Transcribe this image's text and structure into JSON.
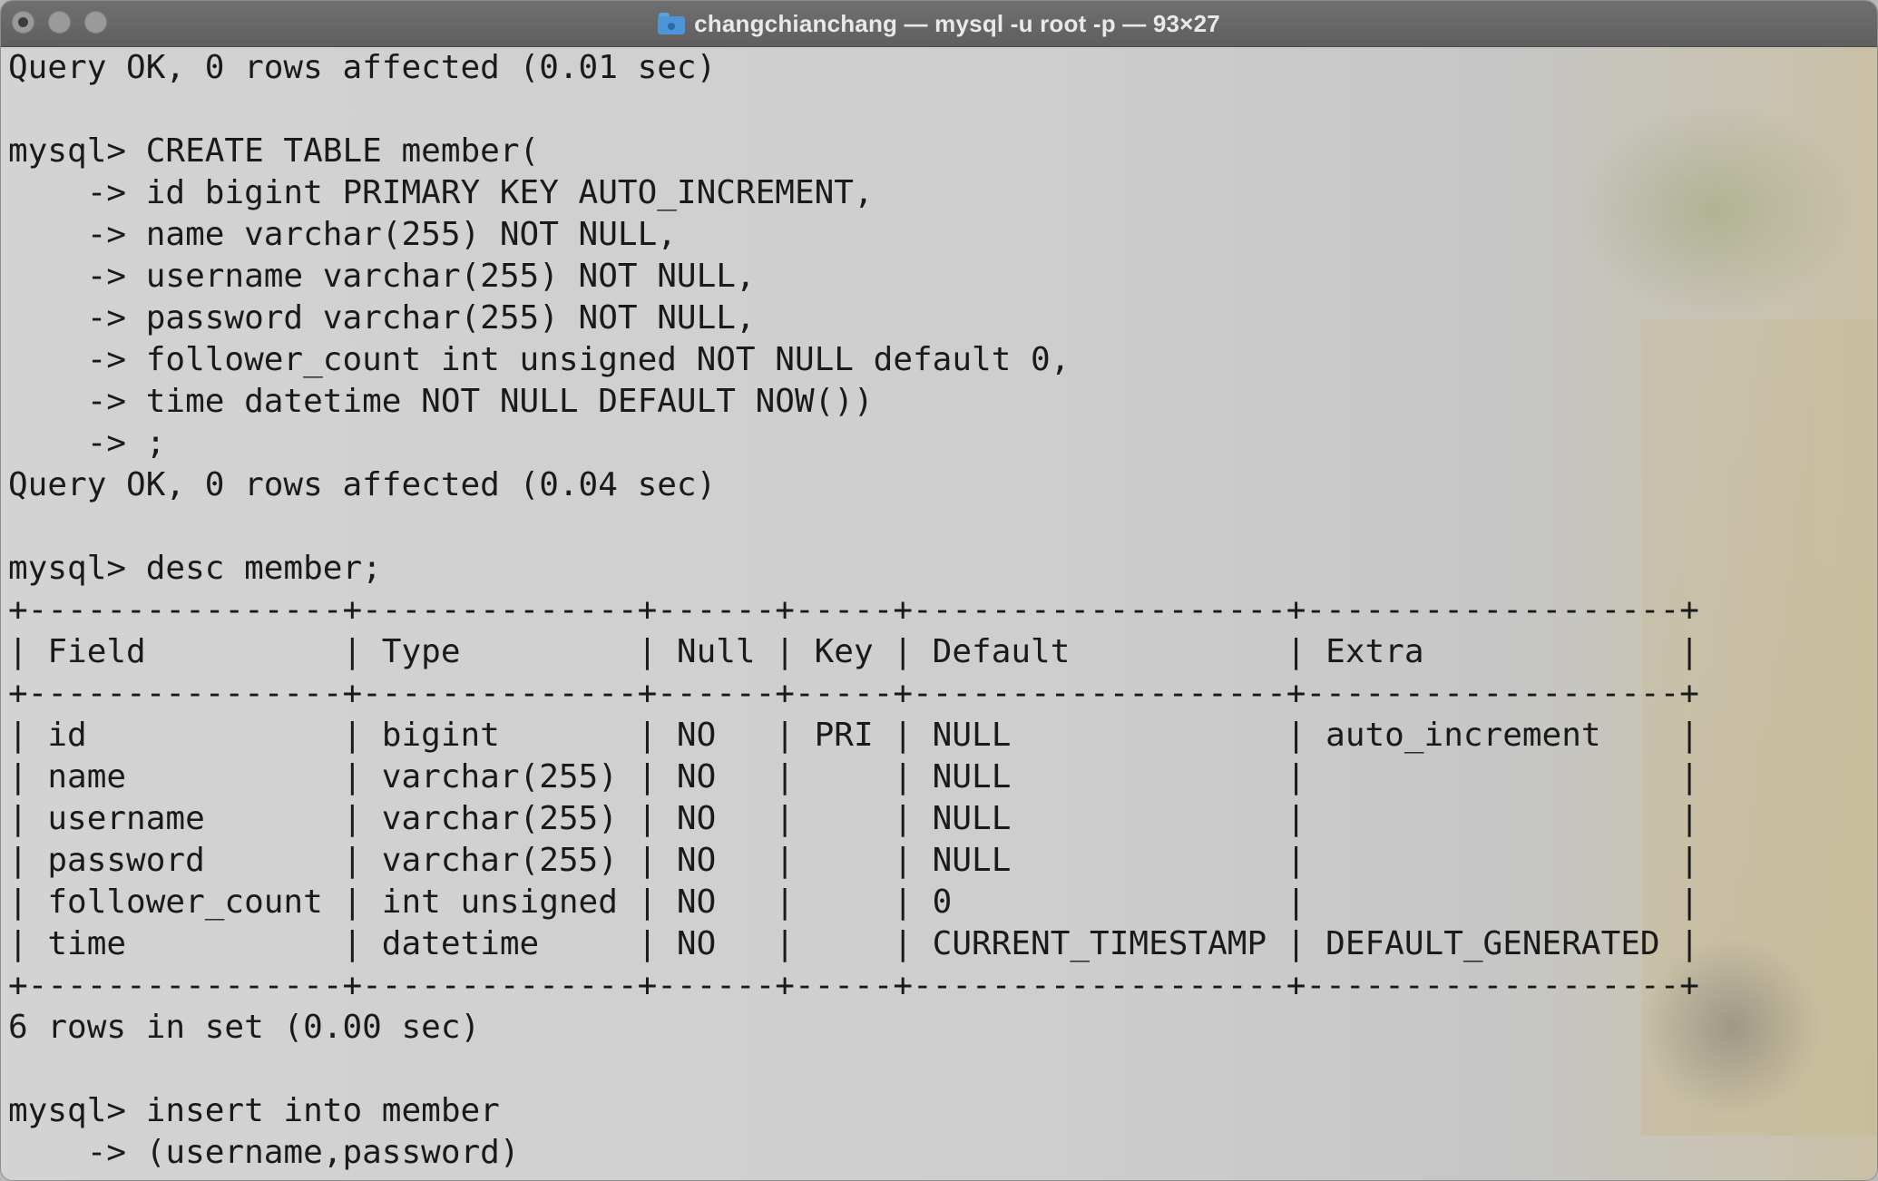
{
  "window": {
    "title": "changchianchang — mysql -u root -p — 93×27",
    "icons": [
      "close-button-icon",
      "minimize-button-icon",
      "zoom-button-icon",
      "folder-icon"
    ]
  },
  "terminal": {
    "lines": [
      "Query OK, 0 rows affected (0.01 sec)",
      "",
      "mysql> CREATE TABLE member(",
      "    -> id bigint PRIMARY KEY AUTO_INCREMENT,",
      "    -> name varchar(255) NOT NULL,",
      "    -> username varchar(255) NOT NULL,",
      "    -> password varchar(255) NOT NULL,",
      "    -> follower_count int unsigned NOT NULL default 0,",
      "    -> time datetime NOT NULL DEFAULT NOW())",
      "    -> ;",
      "Query OK, 0 rows affected (0.04 sec)",
      "",
      "mysql> desc member;",
      "+----------------+--------------+------+-----+-------------------+-------------------+",
      "| Field          | Type         | Null | Key | Default           | Extra             |",
      "+----------------+--------------+------+-----+-------------------+-------------------+",
      "| id             | bigint       | NO   | PRI | NULL              | auto_increment    |",
      "| name           | varchar(255) | NO   |     | NULL              |                   |",
      "| username       | varchar(255) | NO   |     | NULL              |                   |",
      "| password       | varchar(255) | NO   |     | NULL              |                   |",
      "| follower_count | int unsigned | NO   |     | 0                 |                   |",
      "| time           | datetime     | NO   |     | CURRENT_TIMESTAMP | DEFAULT_GENERATED |",
      "+----------------+--------------+------+-----+-------------------+-------------------+",
      "6 rows in set (0.00 sec)",
      "",
      "mysql> insert into member",
      "    -> (username,password)"
    ]
  }
}
